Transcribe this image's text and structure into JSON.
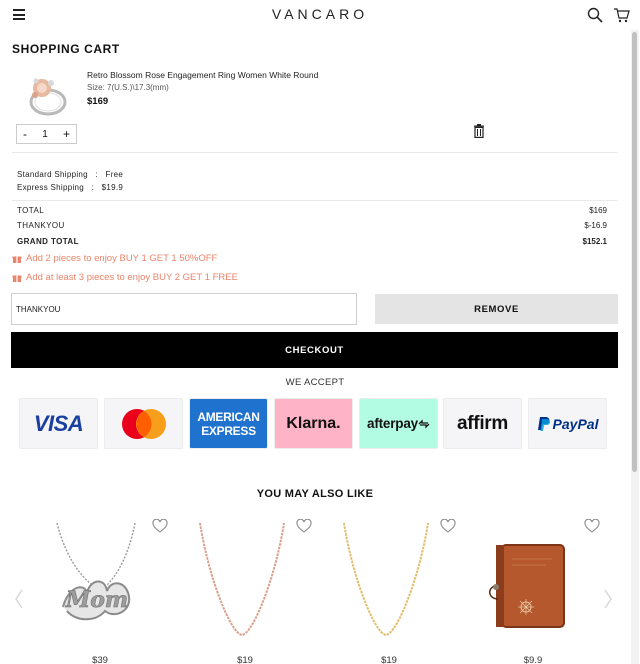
{
  "header": {
    "logo": "VANCARO"
  },
  "page_title": "SHOPPING CART",
  "item": {
    "name": "Retro Blossom Rose Engagement Ring Women White Round",
    "size": "Size: 7(U.S.)\\17.3(mm)",
    "price": "$169",
    "quantity": "1",
    "minus": "-",
    "plus": "+"
  },
  "shipping": [
    {
      "label": "Standard Shipping",
      "sep": ":",
      "value": "Free"
    },
    {
      "label": "Express Shipping",
      "sep": ":",
      "value": "$19.9"
    }
  ],
  "totals": {
    "total_label": "TOTAL",
    "total_value": "$169",
    "coupon_label": "THANKYOU",
    "coupon_value": "$-16.9",
    "grand_label": "GRAND TOTAL",
    "grand_value": "$152.1"
  },
  "promos": [
    "Add 2 pieces to enjoy BUY 1 GET 1 50%OFF",
    "Add at least 3 pieces to enjoy BUY 2 GET 1 FREE"
  ],
  "coupon": {
    "value": "THANKYOU",
    "remove_label": "REMOVE"
  },
  "checkout_label": "CHECKOUT",
  "payments": {
    "heading": "WE ACCEPT",
    "visa": "VISA",
    "amex_1": "AMERICAN",
    "amex_2": "EXPRESS",
    "klarna": "Klarna.",
    "afterpay": "afterpay",
    "affirm": "affirm",
    "paypal": "PayPal"
  },
  "recommendations": {
    "heading": "YOU MAY ALSO LIKE",
    "items": [
      {
        "price": "$39",
        "script": "Mom"
      },
      {
        "price": "$19"
      },
      {
        "price": "$19"
      },
      {
        "price": "$9.9"
      }
    ]
  },
  "colors": {
    "accent": "#e9856b",
    "checkout_bg": "#000000",
    "remove_bg": "#e4e4e4"
  }
}
